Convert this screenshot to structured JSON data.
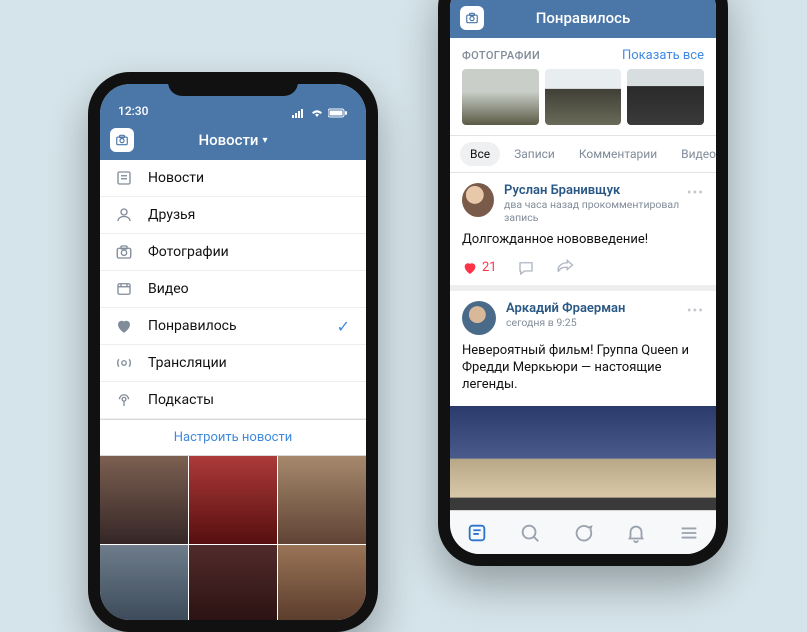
{
  "colors": {
    "brand": "#4a76a8",
    "link": "#3f8ae0",
    "like": "#ff3347"
  },
  "phone1": {
    "status": {
      "time": "12:30"
    },
    "nav_title": "Новости",
    "menu": [
      {
        "icon": "newsfeed-icon",
        "label": "Новости"
      },
      {
        "icon": "friends-icon",
        "label": "Друзья"
      },
      {
        "icon": "photos-icon",
        "label": "Фотографии"
      },
      {
        "icon": "video-icon",
        "label": "Видео"
      },
      {
        "icon": "likes-icon",
        "label": "Понравилось",
        "selected": true
      },
      {
        "icon": "live-icon",
        "label": "Трансляции"
      },
      {
        "icon": "podcasts-icon",
        "label": "Подкасты"
      }
    ],
    "configure_label": "Настроить новости"
  },
  "phone2": {
    "nav_title": "Понравилось",
    "photos": {
      "header": "ФОТОГРАФИИ",
      "show_all": "Показать все"
    },
    "tabs": [
      "Все",
      "Записи",
      "Комментарии",
      "Видео"
    ],
    "posts": [
      {
        "name": "Руслан Бранивщук",
        "sub": "два часа назад прокомментировал запись",
        "body": "Долгожданное нововведение!",
        "likes": "21"
      },
      {
        "name": "Аркадий Фраерман",
        "sub": "сегодня в 9:25",
        "body": "Невероятный фильм! Группа Queen и Фредди Меркьюри — настоящие легенды."
      }
    ]
  }
}
